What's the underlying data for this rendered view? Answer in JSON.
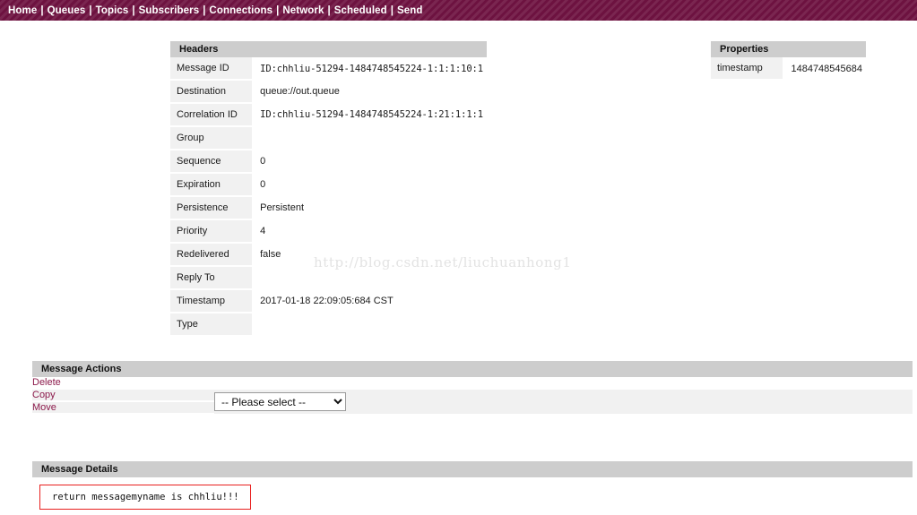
{
  "nav": {
    "separator": "|",
    "items": [
      {
        "label": "Home",
        "name": "nav-home"
      },
      {
        "label": "Queues",
        "name": "nav-queues"
      },
      {
        "label": "Topics",
        "name": "nav-topics"
      },
      {
        "label": "Subscribers",
        "name": "nav-subscribers"
      },
      {
        "label": "Connections",
        "name": "nav-connections"
      },
      {
        "label": "Network",
        "name": "nav-network"
      },
      {
        "label": "Scheduled",
        "name": "nav-scheduled"
      },
      {
        "label": "Send",
        "name": "nav-send"
      }
    ]
  },
  "headers": {
    "title": "Headers",
    "rows": [
      {
        "key": "Message ID",
        "value": "ID:chhliu-51294-1484748545224-1:1:1:10:1",
        "mono": true
      },
      {
        "key": "Destination",
        "value": "queue://out.queue",
        "mono": false
      },
      {
        "key": "Correlation ID",
        "value": "ID:chhliu-51294-1484748545224-1:21:1:1:1",
        "mono": true
      },
      {
        "key": "Group",
        "value": "",
        "mono": false
      },
      {
        "key": "Sequence",
        "value": "0",
        "mono": false
      },
      {
        "key": "Expiration",
        "value": "0",
        "mono": false
      },
      {
        "key": "Persistence",
        "value": "Persistent",
        "mono": false
      },
      {
        "key": "Priority",
        "value": "4",
        "mono": false
      },
      {
        "key": "Redelivered",
        "value": "false",
        "mono": false
      },
      {
        "key": "Reply To",
        "value": "",
        "mono": false
      },
      {
        "key": "Timestamp",
        "value": "2017-01-18 22:09:05:684 CST",
        "mono": false
      },
      {
        "key": "Type",
        "value": "",
        "mono": false
      }
    ]
  },
  "properties": {
    "title": "Properties",
    "rows": [
      {
        "key": "timestamp",
        "value": "1484748545684"
      }
    ]
  },
  "message_actions": {
    "title": "Message Actions",
    "delete_label": "Delete",
    "copy_label": "Copy",
    "move_label": "Move",
    "select": {
      "selected": "-- Please select --",
      "options": [
        "-- Please select --"
      ]
    }
  },
  "message_details": {
    "title": "Message Details",
    "body": "return messagemyname is chhliu!!!"
  },
  "watermark": {
    "text": "http://blog.csdn.net/liuchuanhong1"
  },
  "colors": {
    "nav_background": "#6d1240",
    "panel_bar": "#cdcdcd",
    "link": "#8c1a4b",
    "message_box_border": "#e8201f",
    "row_label_background": "#f1f1f1"
  }
}
